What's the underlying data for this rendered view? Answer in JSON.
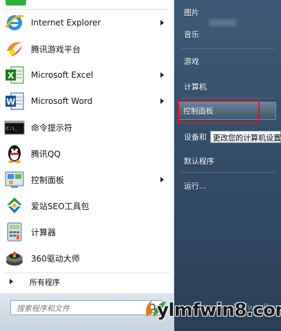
{
  "programs": [
    {
      "label": "Internet Explorer",
      "icon": "ie-icon",
      "arrow": true
    },
    {
      "label": "腾讯游戏平台",
      "icon": "tencent-games-icon",
      "arrow": false
    },
    {
      "label": "Microsoft Excel",
      "icon": "excel-icon",
      "arrow": true
    },
    {
      "label": "Microsoft Word",
      "icon": "word-icon",
      "arrow": true
    },
    {
      "label": "命令提示符",
      "icon": "cmd-icon",
      "arrow": false
    },
    {
      "label": "腾讯QQ",
      "icon": "qq-icon",
      "arrow": false
    },
    {
      "label": "控制面板",
      "icon": "control-panel-icon",
      "arrow": true
    },
    {
      "label": "爱站SEO工具包",
      "icon": "aizhan-seo-icon",
      "arrow": false
    },
    {
      "label": "计算器",
      "icon": "calculator-icon",
      "arrow": false
    },
    {
      "label": "360驱动大师",
      "icon": "driver-master-icon",
      "arrow": false
    }
  ],
  "all_programs": "所有程序",
  "search": {
    "placeholder": "搜索程序和文件"
  },
  "right_menu": {
    "pictures": "图片",
    "music": "音乐",
    "games": "游戏",
    "computer": "计算机",
    "control_panel": "控制面板",
    "devices": "设备和",
    "default_programs": "默认程序",
    "run": "运行..."
  },
  "tooltip": "更改您的计算机设置",
  "watermark": {
    "text": "ylmfwin8.com",
    "faint": "www.ylmfwin8.com"
  },
  "colors": {
    "highlight_border": "#e0131e",
    "right_pane": "#35506c"
  }
}
